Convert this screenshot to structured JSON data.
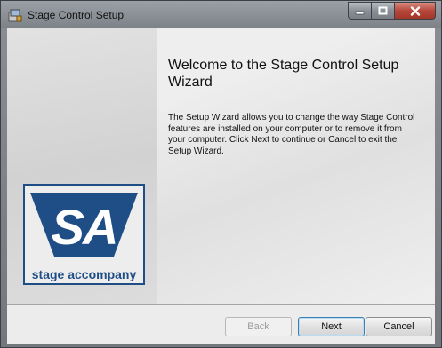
{
  "window": {
    "title": "Stage Control Setup",
    "icons": {
      "app": "setup-installer-icon",
      "minimize": "minimize-icon",
      "maximize": "maximize-icon",
      "close": "close-icon"
    },
    "colors": {
      "close_button": "#b7473a",
      "brand_blue": "#1f4e86"
    }
  },
  "welcome": {
    "heading": "Welcome to the Stage Control Setup Wizard",
    "body": "The Setup Wizard allows you to change the way Stage Control features are installed on your computer or to remove it from your computer. Click Next to continue or Cancel to exit the Setup Wizard."
  },
  "logo": {
    "mark": "SA",
    "caption": "stage accompany"
  },
  "buttons": {
    "back": "Back",
    "next": "Next",
    "cancel": "Cancel"
  }
}
